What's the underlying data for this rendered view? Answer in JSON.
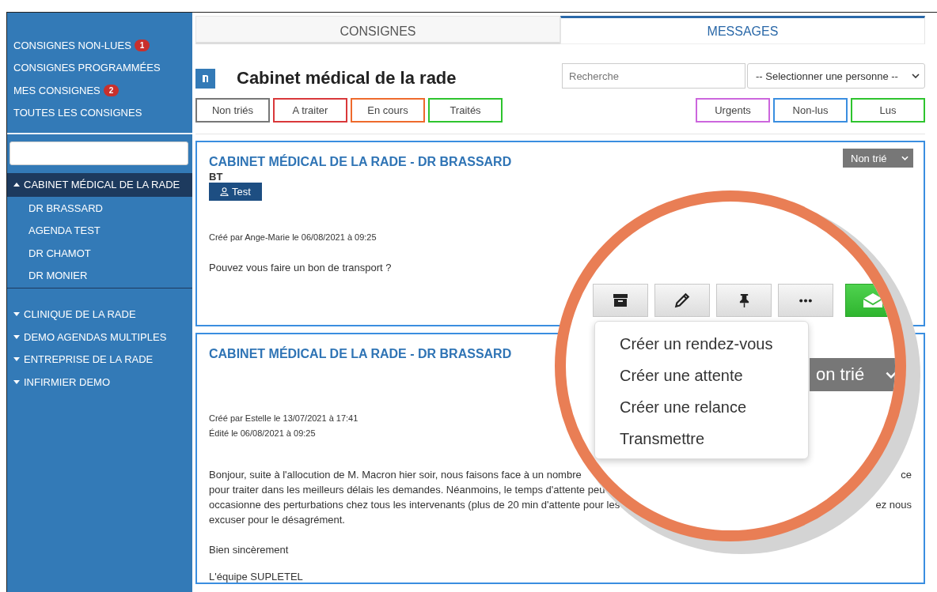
{
  "sidebar": {
    "nav": [
      {
        "label": "CONSIGNES NON-LUES",
        "badge": "1"
      },
      {
        "label": "CONSIGNES PROGRAMMÉES"
      },
      {
        "label": "MES CONSIGNES",
        "badge": "2"
      },
      {
        "label": "TOUTES LES CONSIGNES"
      }
    ],
    "tree": [
      {
        "label": "CABINET MÉDICAL DE LA RADE",
        "expanded": true,
        "selected": true,
        "children": [
          {
            "label": "DR BRASSARD"
          },
          {
            "label": "AGENDA TEST"
          },
          {
            "label": "DR CHAMOT"
          },
          {
            "label": "DR MONIER"
          }
        ]
      },
      {
        "label": "CLINIQUE DE LA RADE",
        "expanded": false,
        "selected": false
      },
      {
        "label": "DEMO AGENDAS MULTIPLES",
        "expanded": false,
        "selected": false
      },
      {
        "label": "ENTREPRISE DE LA RADE",
        "expanded": false,
        "selected": false
      },
      {
        "label": "INFIRMIER DEMO",
        "expanded": false,
        "selected": false
      }
    ]
  },
  "tabs": [
    {
      "label": "CONSIGNES",
      "selected": false
    },
    {
      "label": "MESSAGES",
      "selected": true
    }
  ],
  "header": {
    "title": "Cabinet médical de la rade",
    "search": {
      "placeholder": "Recherche"
    },
    "person_select": "-- Selectionner une personne --"
  },
  "filters_left": [
    {
      "label": "Non triés",
      "color": "#777777"
    },
    {
      "label": "A traiter",
      "color": "#d9383a"
    },
    {
      "label": "En cours",
      "color": "#ee6a2c"
    },
    {
      "label": "Traités",
      "color": "#2ec42e"
    }
  ],
  "filters_right": [
    {
      "label": "Urgents",
      "color": "#cc66dd"
    },
    {
      "label": "Non-lus",
      "color": "#3a8ee0"
    },
    {
      "label": "Lus",
      "color": "#2ec42e"
    }
  ],
  "messages": [
    {
      "title": "CABINET MÉDICAL DE LA RADE - DR BRASSARD",
      "status": "Non trié",
      "initials": "BT",
      "tag": "Test",
      "meta": [
        "Créé par Ange-Marie le 06/08/2021 à 09:25"
      ],
      "body": [
        {
          "left": "Pouvez vous faire un bon de transport ?"
        }
      ]
    },
    {
      "title": "CABINET MÉDICAL DE LA RADE - DR BRASSARD",
      "meta": [
        "Créé par Estelle le 13/07/2021 à 17:41",
        "Édité le 06/08/2021 à 09:25"
      ],
      "body": [
        {
          "left": "Bonjour, suite à l'allocution de M. Macron hier soir, nous faisons face à un nombre",
          "right": "ce"
        },
        {
          "left": "pour traiter dans les meilleurs délais les demandes. Néanmoins, le temps d'attente peu"
        },
        {
          "left": "occasionne des perturbations chez tous les intervenants (plus de 20 min d'attente pour les",
          "right": "ez nous"
        },
        {
          "left": "excuser pour le désagrément."
        }
      ],
      "closing": [
        "Bien sincèrement",
        "L'équipe SUPLETEL"
      ]
    }
  ],
  "magnifier": {
    "actions": [
      {
        "kind": "archive"
      },
      {
        "kind": "edit"
      },
      {
        "kind": "pin"
      },
      {
        "kind": "more"
      },
      {
        "kind": "read"
      }
    ],
    "menu": [
      "Créer un rendez-vous",
      "Créer une attente",
      "Créer une relance",
      "Transmettre"
    ],
    "status": "on trié"
  }
}
